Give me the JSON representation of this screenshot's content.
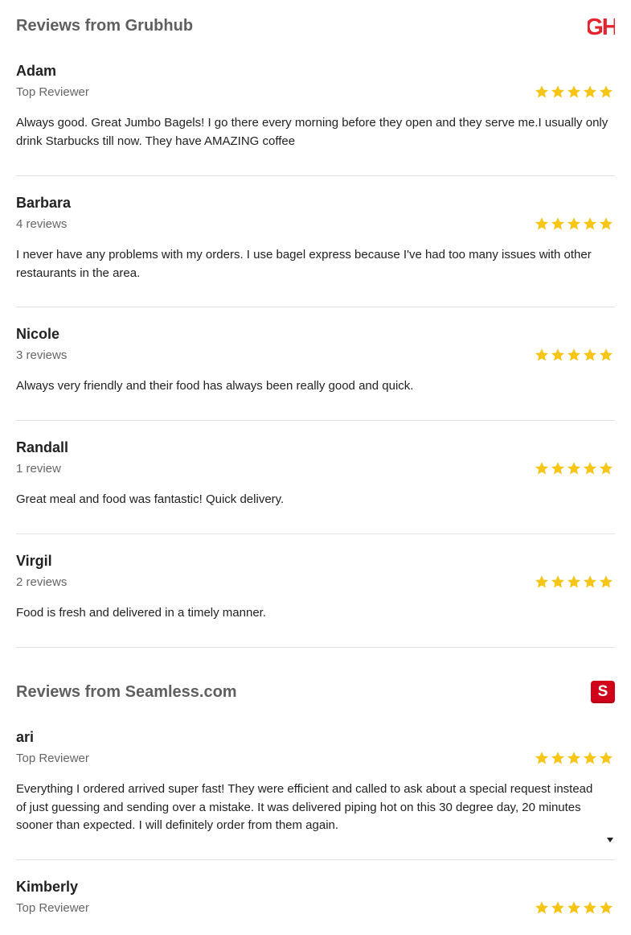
{
  "grubhub": {
    "title": "Reviews from Grubhub",
    "logo_text": "GH",
    "logo_color": "#e4242f",
    "reviews": [
      {
        "name": "Adam",
        "meta": "Top Reviewer",
        "rating": 5,
        "text": "Always good. Great Jumbo Bagels! I go there every morning before they open and they serve me.I usually only drink Starbucks till now. They have AMAZING coffee"
      },
      {
        "name": "Barbara",
        "meta": "4 reviews",
        "rating": 5,
        "text": "I never have any problems with my orders. I use bagel express because I've had too many issues with other restaurants in the area."
      },
      {
        "name": "Nicole",
        "meta": "3 reviews",
        "rating": 5,
        "text": "Always very friendly and their food has always been really good and quick."
      },
      {
        "name": "Randall",
        "meta": "1 review",
        "rating": 5,
        "text": "Great meal and food was fantastic! Quick delivery."
      },
      {
        "name": "Virgil",
        "meta": "2 reviews",
        "rating": 5,
        "text": "Food is fresh and delivered in a timely manner."
      }
    ]
  },
  "seamless": {
    "title": "Reviews from Seamless.com",
    "logo_text": "S",
    "logo_color": "#d0021b",
    "reviews": [
      {
        "name": "ari",
        "meta": "Top Reviewer",
        "rating": 5,
        "text": "Everything I ordered arrived super fast! They were efficient and called to ask about a special request instead of just guessing and sending over a mistake. It was delivered piping hot on this 30 degree day, 20 minutes sooner than expected. I will definitely order from them again."
      },
      {
        "name": "Kimberly",
        "meta": "Top Reviewer",
        "rating": 5,
        "text": ""
      }
    ]
  },
  "colors": {
    "star": "#f5c518",
    "divider": "#e3e3e3"
  },
  "icons": {
    "star": "star-icon",
    "expand": "caret-down-icon"
  }
}
